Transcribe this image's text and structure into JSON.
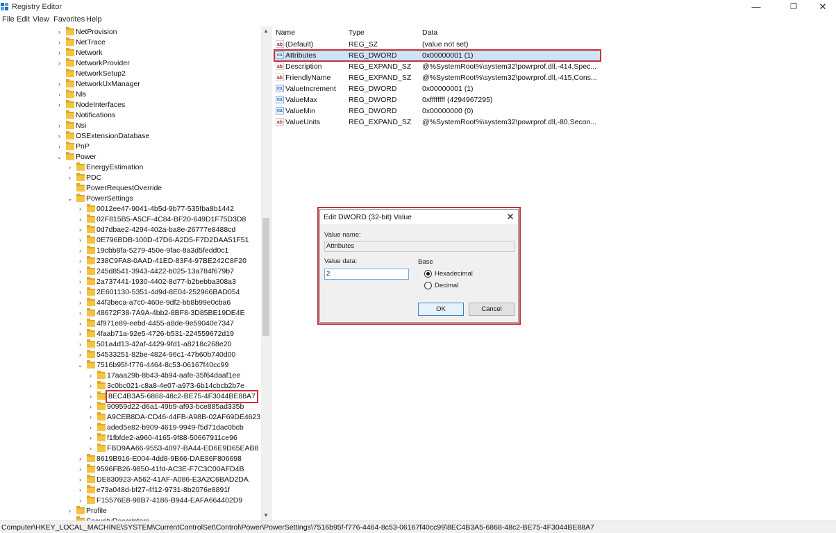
{
  "window": {
    "title": "Registry Editor",
    "minimize": "—",
    "maximize": "❐",
    "close": "✕"
  },
  "menu": [
    "File",
    "Edit",
    "View",
    "Favorites",
    "Help"
  ],
  "tree": [
    {
      "label": "NetProvision",
      "expander": "›",
      "level": 0
    },
    {
      "label": "NetTrace",
      "expander": "›",
      "level": 0
    },
    {
      "label": "Network",
      "expander": "›",
      "level": 0
    },
    {
      "label": "NetworkProvider",
      "expander": "›",
      "level": 0
    },
    {
      "label": "NetworkSetup2",
      "expander": "",
      "level": 0
    },
    {
      "label": "NetworkUxManager",
      "expander": "›",
      "level": 0
    },
    {
      "label": "Nls",
      "expander": "›",
      "level": 0
    },
    {
      "label": "NodeInterfaces",
      "expander": "›",
      "level": 0
    },
    {
      "label": "Notifications",
      "expander": "",
      "level": 0
    },
    {
      "label": "Nsi",
      "expander": "›",
      "level": 0
    },
    {
      "label": "OSExtensionDatabase",
      "expander": "›",
      "level": 0
    },
    {
      "label": "PnP",
      "expander": "›",
      "level": 0
    },
    {
      "label": "Power",
      "expander": "⌄",
      "level": 0
    },
    {
      "label": "EnergyEstimation",
      "expander": "›",
      "level": 1
    },
    {
      "label": "PDC",
      "expander": "›",
      "level": 1
    },
    {
      "label": "PowerRequestOverride",
      "expander": "",
      "level": 1
    },
    {
      "label": "PowerSettings",
      "expander": "⌄",
      "level": 1
    },
    {
      "label": "0012ee47-9041-4b5d-9b77-535fba8b1442",
      "expander": "›",
      "level": 2
    },
    {
      "label": "02F815B5-A5CF-4C84-BF20-649D1F75D3D8",
      "expander": "›",
      "level": 2
    },
    {
      "label": "0d7dbae2-4294-402a-ba8e-26777e8488cd",
      "expander": "›",
      "level": 2
    },
    {
      "label": "0E796BDB-100D-47D6-A2D5-F7D2DAA51F51",
      "expander": "›",
      "level": 2
    },
    {
      "label": "19cbb8fa-5279-450e-9fac-8a3d5fedd0c1",
      "expander": "›",
      "level": 2
    },
    {
      "label": "238C9FA8-0AAD-41ED-83F4-97BE242C8F20",
      "expander": "›",
      "level": 2
    },
    {
      "label": "245d8541-3943-4422-b025-13a784f679b7",
      "expander": "›",
      "level": 2
    },
    {
      "label": "2a737441-1930-4402-8d77-b2bebba308a3",
      "expander": "›",
      "level": 2
    },
    {
      "label": "2E601130-5351-4d9d-8E04-252966BAD054",
      "expander": "›",
      "level": 2
    },
    {
      "label": "44f3beca-a7c0-460e-9df2-bb8b99e0cba6",
      "expander": "›",
      "level": 2
    },
    {
      "label": "48672F38-7A9A-4bb2-8BF8-3D85BE19DE4E",
      "expander": "›",
      "level": 2
    },
    {
      "label": "4f971e89-eebd-4455-a8de-9e59040e7347",
      "expander": "›",
      "level": 2
    },
    {
      "label": "4faab71a-92e5-4726-b531-224559672d19",
      "expander": "›",
      "level": 2
    },
    {
      "label": "501a4d13-42af-4429-9fd1-a8218c268e20",
      "expander": "›",
      "level": 2
    },
    {
      "label": "54533251-82be-4824-96c1-47b60b740d00",
      "expander": "›",
      "level": 2
    },
    {
      "label": "7516b95f-f776-4464-8c53-06167f40cc99",
      "expander": "⌄",
      "level": 2
    },
    {
      "label": "17aaa29b-8b43-4b94-aafe-35f64daaf1ee",
      "expander": "›",
      "level": 3
    },
    {
      "label": "3c0bc021-c8a8-4e07-a973-6b14cbcb2b7e",
      "expander": "›",
      "level": 3
    },
    {
      "label": "8EC4B3A5-6868-48c2-BE75-4F3044BE88A7",
      "expander": "›",
      "level": 3,
      "selected": true
    },
    {
      "label": "90959d22-d6a1-49b9-af93-bce885ad335b",
      "expander": "›",
      "level": 3
    },
    {
      "label": "A9CEB8DA-CD46-44FB-A98B-02AF69DE4623",
      "expander": "›",
      "level": 3
    },
    {
      "label": "aded5e82-b909-4619-9949-f5d71dac0bcb",
      "expander": "›",
      "level": 3
    },
    {
      "label": "f1fbfde2-a960-4165-9f88-50667911ce96",
      "expander": "›",
      "level": 3
    },
    {
      "label": "FBD9AA66-9553-4097-BA44-ED6E9D65EAB8",
      "expander": "›",
      "level": 3
    },
    {
      "label": "8619B916-E004-4dd8-9B66-DAE86F806698",
      "expander": "›",
      "level": 2
    },
    {
      "label": "9596FB26-9850-41fd-AC3E-F7C3C00AFD4B",
      "expander": "›",
      "level": 2
    },
    {
      "label": "DE830923-A562-41AF-A086-E3A2C6BAD2DA",
      "expander": "›",
      "level": 2
    },
    {
      "label": "e73a048d-bf27-4f12-9731-8b2076e8891f",
      "expander": "›",
      "level": 2
    },
    {
      "label": "F15576E8-98B7-4186-B944-EAFA664402D9",
      "expander": "›",
      "level": 2
    },
    {
      "label": "Profile",
      "expander": "›",
      "level": 1
    },
    {
      "label": "SecurityDescriptors",
      "expander": "›",
      "level": 1
    }
  ],
  "tree_scroll": {
    "up": "▲",
    "down": "▼"
  },
  "values": {
    "headers": {
      "name": "Name",
      "type": "Type",
      "data": "Data"
    },
    "rows": [
      {
        "icon": "ab",
        "name": "(Default)",
        "type": "REG_SZ",
        "data": "(value not set)"
      },
      {
        "icon": "bin",
        "name": "Attributes",
        "type": "REG_DWORD",
        "data": "0x00000001 (1)",
        "selected": true
      },
      {
        "icon": "ab",
        "name": "Description",
        "type": "REG_EXPAND_SZ",
        "data": "@%SystemRoot%\\system32\\powrprof.dll,-414,Spec..."
      },
      {
        "icon": "ab",
        "name": "FriendlyName",
        "type": "REG_EXPAND_SZ",
        "data": "@%SystemRoot%\\system32\\powrprof.dll,-415,Cons..."
      },
      {
        "icon": "bin",
        "name": "ValueIncrement",
        "type": "REG_DWORD",
        "data": "0x00000001 (1)"
      },
      {
        "icon": "bin",
        "name": "ValueMax",
        "type": "REG_DWORD",
        "data": "0xffffffff (4294967295)"
      },
      {
        "icon": "bin",
        "name": "ValueMin",
        "type": "REG_DWORD",
        "data": "0x00000000 (0)"
      },
      {
        "icon": "ab",
        "name": "ValueUnits",
        "type": "REG_EXPAND_SZ",
        "data": "@%SystemRoot%\\system32\\powrprof.dll,-80,Secon..."
      }
    ],
    "icon_text": {
      "ab": "ab",
      "bin": "011"
    }
  },
  "dialog": {
    "title": "Edit DWORD (32-bit) Value",
    "close": "✕",
    "value_name_label": "Value name:",
    "value_name": "Attributes",
    "value_data_label": "Value data:",
    "value_data": "2",
    "base_label": "Base",
    "hex_label": "Hexadecimal",
    "dec_label": "Decimal",
    "ok": "OK",
    "cancel": "Cancel"
  },
  "status": {
    "path": "Computer\\HKEY_LOCAL_MACHINE\\SYSTEM\\CurrentControlSet\\Control\\Power\\PowerSettings\\7516b95f-f776-4464-8c53-06167f40cc99\\8EC4B3A5-6868-48c2-BE75-4F3044BE88A7"
  },
  "colors": {
    "accent": "#c8303a",
    "selection": "#cce4f7",
    "folder": "#f5c342"
  }
}
